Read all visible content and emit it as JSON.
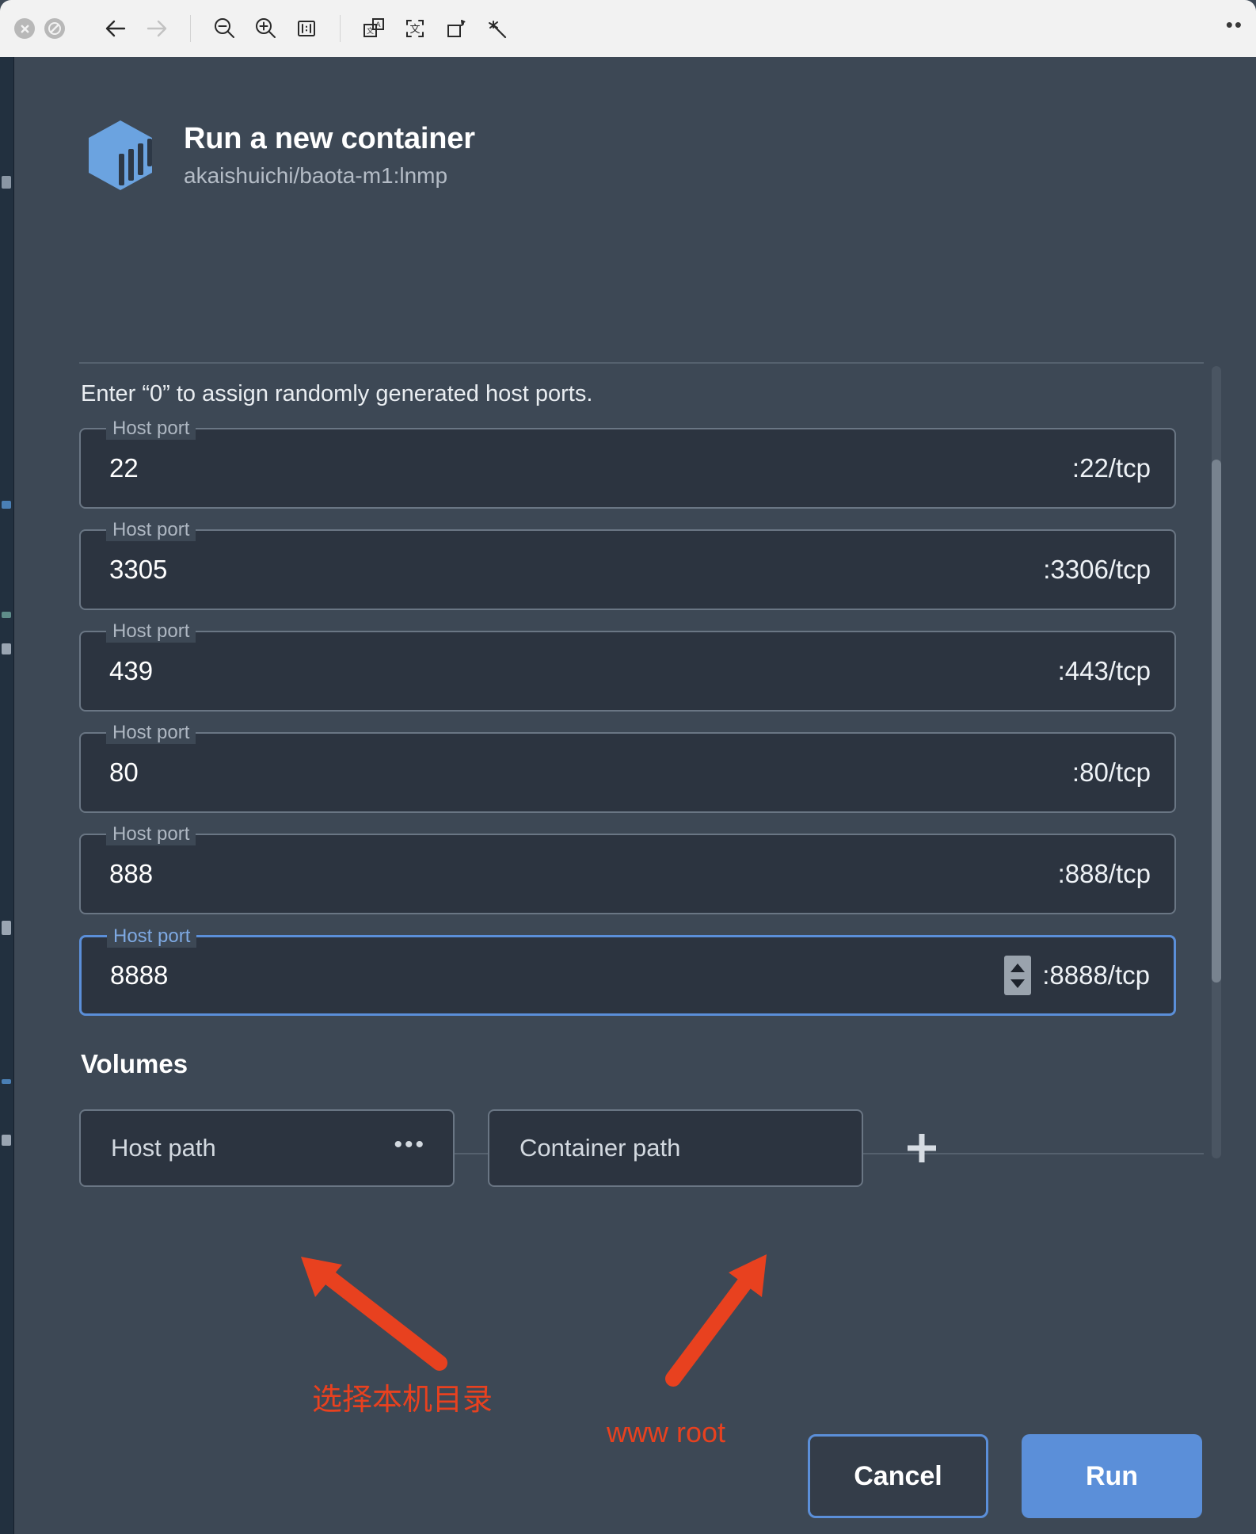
{
  "window_controls": [
    {
      "name": "close",
      "glyph": "✕"
    },
    {
      "name": "minimize",
      "glyph": "⊘"
    }
  ],
  "toolbar": {
    "back_label": "←",
    "forward_label": "→",
    "zoom_out_label": "zoom-out",
    "zoom_in_label": "zoom-in",
    "actual_size_label": "1:1",
    "translate_label": "translate",
    "ocr_label": "ocr-select",
    "rotate_label": "rotate",
    "enhance_label": "enhance",
    "more_label": "••"
  },
  "dialog": {
    "title": "Run a new container",
    "subtitle": "akaishuichi/baota-m1:lnmp",
    "logo_icon": "docker-container-icon",
    "hint": "Enter “0” to assign randomly generated host ports."
  },
  "ports": [
    {
      "label": "Host port",
      "value": "22",
      "suffix": ":22/tcp",
      "focused": false
    },
    {
      "label": "Host port",
      "value": "3305",
      "suffix": ":3306/tcp",
      "focused": false
    },
    {
      "label": "Host port",
      "value": "439",
      "suffix": ":443/tcp",
      "focused": false
    },
    {
      "label": "Host port",
      "value": "80",
      "suffix": ":80/tcp",
      "focused": false
    },
    {
      "label": "Host port",
      "value": "888",
      "suffix": ":888/tcp",
      "focused": false
    },
    {
      "label": "Host port",
      "value": "8888",
      "suffix": ":8888/tcp",
      "focused": true
    }
  ],
  "volumes": {
    "heading": "Volumes",
    "host_path_placeholder": "Host path",
    "host_path_value": "",
    "browse_label": "•••",
    "container_path_placeholder": "Container path",
    "container_path_value": "",
    "add_label": "+"
  },
  "annotations": [
    {
      "text": "选择本机目录",
      "color": "#e8411f"
    },
    {
      "text": "www root",
      "color": "#e8411f"
    }
  ],
  "footer": {
    "cancel_label": "Cancel",
    "run_label": "Run"
  },
  "colors": {
    "accent_blue": "#5b8fd9",
    "dialog_bg": "#3d4855",
    "field_bg": "#2c3440",
    "annotation_red": "#e8411f",
    "toolbar_bg": "#f2f2f2"
  }
}
